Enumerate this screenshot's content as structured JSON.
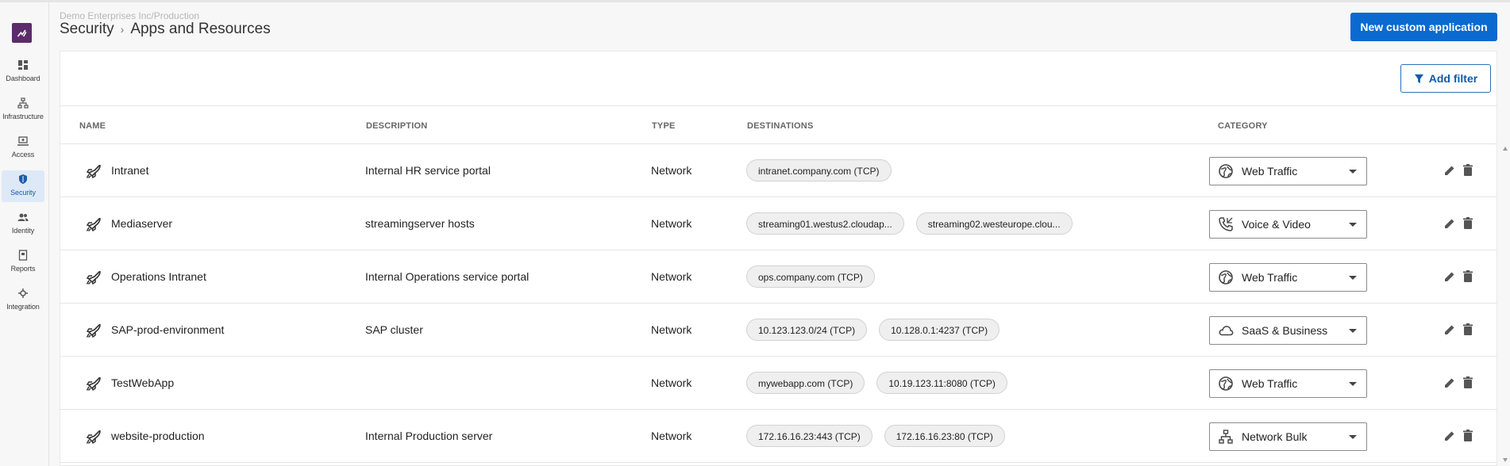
{
  "sidebar": {
    "logo": "wandera-logo",
    "items": [
      {
        "label": "Dashboard",
        "icon": "dashboard-icon"
      },
      {
        "label": "Infrastructure",
        "icon": "infrastructure-icon"
      },
      {
        "label": "Access",
        "icon": "access-icon"
      },
      {
        "label": "Security",
        "icon": "shield-icon",
        "active": true
      },
      {
        "label": "Identity",
        "icon": "identity-icon"
      },
      {
        "label": "Reports",
        "icon": "reports-icon"
      },
      {
        "label": "Integration",
        "icon": "integration-icon"
      }
    ]
  },
  "header": {
    "org": "Demo Enterprises Inc/Production",
    "breadcrumb": [
      "Security",
      "Apps and Resources"
    ],
    "separator": "›",
    "new_button": "New custom application"
  },
  "toolbar": {
    "add_filter": "Add filter"
  },
  "table": {
    "columns": [
      "NAME",
      "DESCRIPTION",
      "TYPE",
      "DESTINATIONS",
      "CATEGORY"
    ],
    "rows": [
      {
        "name": "Intranet",
        "description": "Internal HR service portal",
        "type": "Network",
        "destinations": [
          "intranet.company.com (TCP)"
        ],
        "category": "Web Traffic",
        "category_icon": "globe-icon"
      },
      {
        "name": "Mediaserver",
        "description": "streamingserver hosts",
        "type": "Network",
        "destinations": [
          "streaming01.westus2.cloudap...",
          "streaming02.westeurope.clou..."
        ],
        "category": "Voice & Video",
        "category_icon": "phone-icon"
      },
      {
        "name": "Operations Intranet",
        "description": "Internal Operations service portal",
        "type": "Network",
        "destinations": [
          "ops.company.com (TCP)"
        ],
        "category": "Web Traffic",
        "category_icon": "globe-icon"
      },
      {
        "name": "SAP-prod-environment",
        "description": "SAP cluster",
        "type": "Network",
        "destinations": [
          "10.123.123.0/24 (TCP)",
          "10.128.0.1:4237 (TCP)"
        ],
        "category": "SaaS & Business",
        "category_icon": "cloud-icon"
      },
      {
        "name": "TestWebApp",
        "description": "",
        "type": "Network",
        "destinations": [
          "mywebapp.com (TCP)",
          "10.19.123.11:8080 (TCP)"
        ],
        "category": "Web Traffic",
        "category_icon": "globe-icon"
      },
      {
        "name": "website-production",
        "description": "Internal Production server",
        "type": "Network",
        "destinations": [
          "172.16.16.23:443 (TCP)",
          "172.16.16.23:80 (TCP)"
        ],
        "category": "Network Bulk",
        "category_icon": "network-icon"
      }
    ]
  },
  "colors": {
    "primary": "#0a6ad0",
    "brand": "#5c2b6a",
    "active_nav": "#dde9f7"
  }
}
